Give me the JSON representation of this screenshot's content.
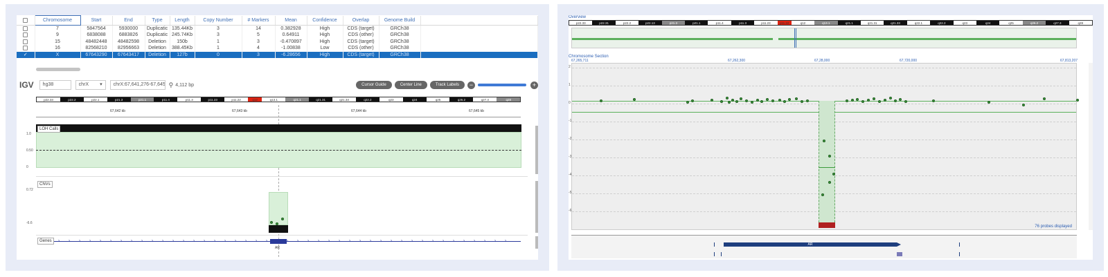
{
  "table": {
    "columns": [
      "Chromosome",
      "Start",
      "End",
      "Type",
      "Length",
      "Copy Number",
      "# Markers",
      "Mean",
      "Confidence",
      "Overlap",
      "Genome Build"
    ],
    "rows": [
      [
        "7",
        "5847564",
        "5930000",
        "Duplicatic",
        "135.44Kb",
        "3",
        "14",
        "0.382928",
        "High",
        "CDS (target)",
        "GRCh38"
      ],
      [
        "9",
        "6838088",
        "6883826",
        "Duplicatic",
        "245.74Kb",
        "3",
        "5",
        "0.64911",
        "High",
        "CDS (other)",
        "GRCh38"
      ],
      [
        "15",
        "48482448",
        "48482598",
        "Deletion",
        "150b",
        "1",
        "3",
        "-0.470897",
        "High",
        "CDS (target)",
        "GRCh38"
      ],
      [
        "16",
        "82568210",
        "82956663",
        "Deletion",
        "388.45Kb",
        "1",
        "4",
        "-1.00838",
        "Low",
        "CDS (other)",
        "GRCh38"
      ],
      [
        "X",
        "67643290",
        "67643417",
        "Deletion",
        "127b",
        "0",
        "3",
        "-6.28656",
        "High",
        "CDS (target)",
        "GRCh38"
      ]
    ],
    "selected_row": 4
  },
  "igv": {
    "logo": "IGV",
    "genome": "hg38",
    "chromosome": "chrX",
    "locus": "chrX:67,641,276-67,645,387",
    "width_label": "4,112 bp",
    "buttons": [
      "Cursor Guide",
      "Center Line",
      "Track Labels"
    ],
    "ruler": [
      "67,642 kb",
      "67,643 kb",
      "67,644 kb",
      "67,645 kb"
    ],
    "loh_label": "LOH Calls",
    "loh_axis": [
      "1.0",
      "0.50",
      "0"
    ],
    "cnv_label": "CNVs",
    "cnv_axis": [
      "0.72",
      "-6.6"
    ],
    "genes_label": "Genes",
    "gene_name": "AR",
    "bands": [
      "p22.33",
      "p22.2",
      "p22.1",
      "p21.3",
      "p21.1",
      "p11.4",
      "p11.3",
      "p11.23",
      "p11.22",
      "q12",
      "q13.1",
      "q21.1",
      "q21.31",
      "q21.33",
      "q22.2",
      "q23",
      "q24",
      "q25",
      "q26.2",
      "q27.3",
      "q28"
    ]
  },
  "right": {
    "overview_label": "Overview",
    "section_label": "Chromosome Section",
    "ticks": [
      "67,265,711",
      "67,262,300",
      "67,28,000",
      "67,720,000",
      "67,813,207"
    ],
    "y_ticks": [
      "2",
      "1",
      "0",
      "-1",
      "-2",
      "-3",
      "-4",
      "-5",
      "-6"
    ],
    "probes_label": "76 probes displayed",
    "gene_name": "AR",
    "bands": [
      "p22.33",
      "p22.31",
      "p22.2",
      "p22.13",
      "p21.3",
      "p21.1",
      "p11.4",
      "p11.3",
      "p11.23",
      "p11.22",
      "q12",
      "q13.1",
      "q21.1",
      "q21.31",
      "q21.33",
      "q22.1",
      "q22.2",
      "q23",
      "q24",
      "q25",
      "q26.2",
      "q27.3",
      "q28"
    ]
  }
}
